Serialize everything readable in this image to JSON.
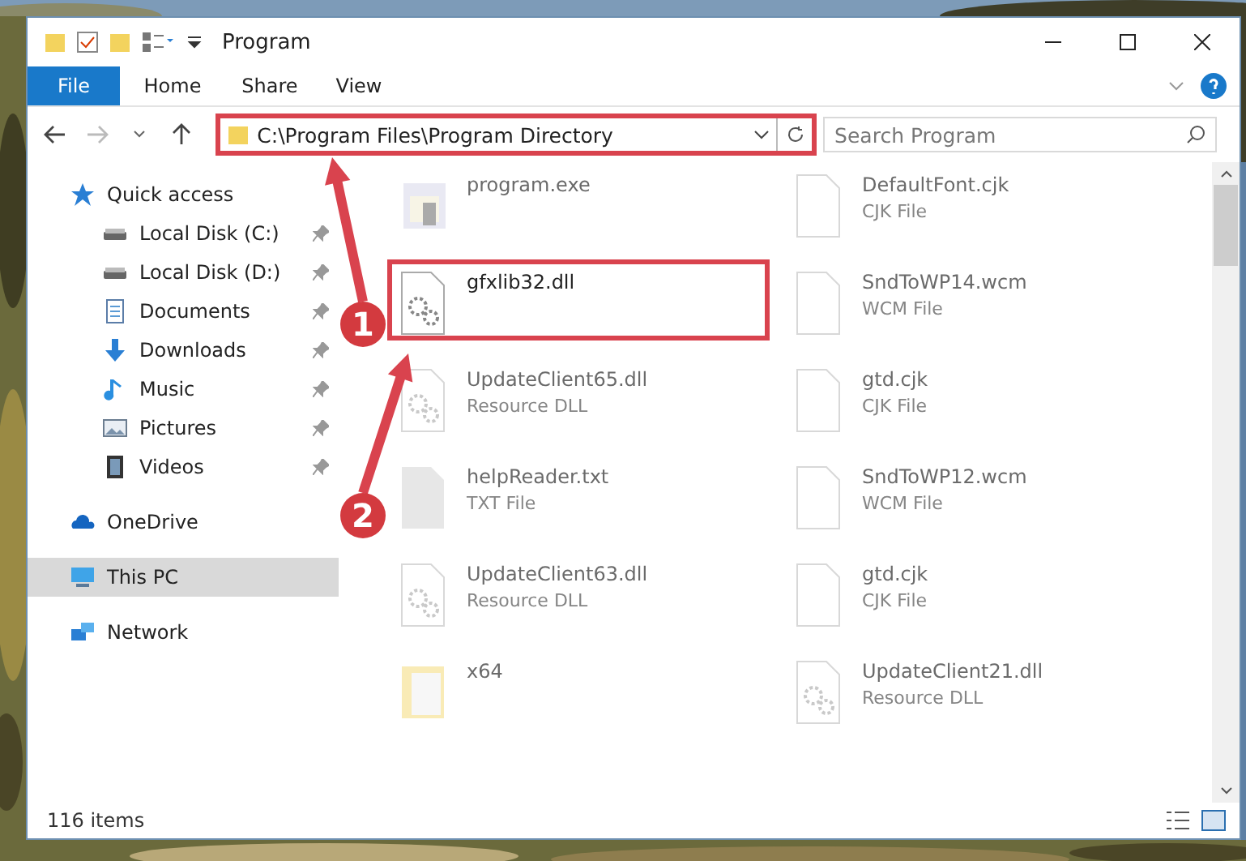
{
  "window": {
    "title": "Program"
  },
  "ribbon_tabs": [
    {
      "label": "File",
      "selected": true
    },
    {
      "label": "Home",
      "selected": false
    },
    {
      "label": "Share",
      "selected": false
    },
    {
      "label": "View",
      "selected": false
    }
  ],
  "address_bar": {
    "path": "C:\\Program Files\\Program Directory",
    "highlighted": true
  },
  "search": {
    "placeholder": "Search Program"
  },
  "sidebar": {
    "items": [
      {
        "label": "Quick access",
        "kind": "star",
        "selected": false,
        "children": [
          {
            "label": "Local Disk (C:)",
            "kind": "disk",
            "pinned": true,
            "selected": false
          },
          {
            "label": "Local Disk (D:)",
            "kind": "disk",
            "pinned": true,
            "selected": false
          },
          {
            "label": "Documents",
            "kind": "document",
            "pinned": true,
            "selected": false
          },
          {
            "label": "Downloads",
            "kind": "download",
            "pinned": true,
            "selected": false
          },
          {
            "label": "Music",
            "kind": "music",
            "pinned": true,
            "selected": false
          },
          {
            "label": "Pictures",
            "kind": "pictures",
            "pinned": true,
            "selected": false
          },
          {
            "label": "Videos",
            "kind": "videos",
            "pinned": true,
            "selected": false
          }
        ]
      },
      {
        "label": "OneDrive",
        "kind": "cloud",
        "selected": false
      },
      {
        "label": "This PC",
        "kind": "pc",
        "selected": true
      },
      {
        "label": "Network",
        "kind": "network",
        "selected": false
      }
    ]
  },
  "files": [
    {
      "name": "program.exe",
      "kind": "exe",
      "dimmed": true,
      "highlighted": false
    },
    {
      "name": "DefaultFont.cjk",
      "type": "CJK File",
      "kind": "file",
      "dimmed": true,
      "highlighted": false
    },
    {
      "name": "gfxlib32.dll",
      "kind": "dll",
      "dimmed": false,
      "highlighted": true
    },
    {
      "name": "SndToWP14.wcm",
      "type": "WCM File",
      "kind": "file",
      "dimmed": true,
      "highlighted": false
    },
    {
      "name": "UpdateClient65.dll",
      "type": "Resource DLL",
      "kind": "dll",
      "dimmed": true,
      "highlighted": false
    },
    {
      "name": "gtd.cjk",
      "type": "CJK File",
      "kind": "file",
      "dimmed": true,
      "highlighted": false
    },
    {
      "name": "helpReader.txt",
      "type": "TXT File",
      "kind": "text",
      "dimmed": true,
      "highlighted": false
    },
    {
      "name": "SndToWP12.wcm",
      "type": "WCM File",
      "kind": "file",
      "dimmed": true,
      "highlighted": false
    },
    {
      "name": "UpdateClient63.dll",
      "type": "Resource DLL",
      "kind": "dll",
      "dimmed": true,
      "highlighted": false
    },
    {
      "name": "gtd.cjk",
      "type": "CJK File",
      "kind": "file",
      "dimmed": true,
      "highlighted": false
    },
    {
      "name": "x64",
      "kind": "folder",
      "dimmed": true,
      "highlighted": false
    },
    {
      "name": "UpdateClient21.dll",
      "type": "Resource DLL",
      "kind": "dll",
      "dimmed": true,
      "highlighted": false
    }
  ],
  "status_bar": {
    "count": "116 items"
  },
  "annotations": [
    {
      "label": "1"
    },
    {
      "label": "2"
    }
  ]
}
